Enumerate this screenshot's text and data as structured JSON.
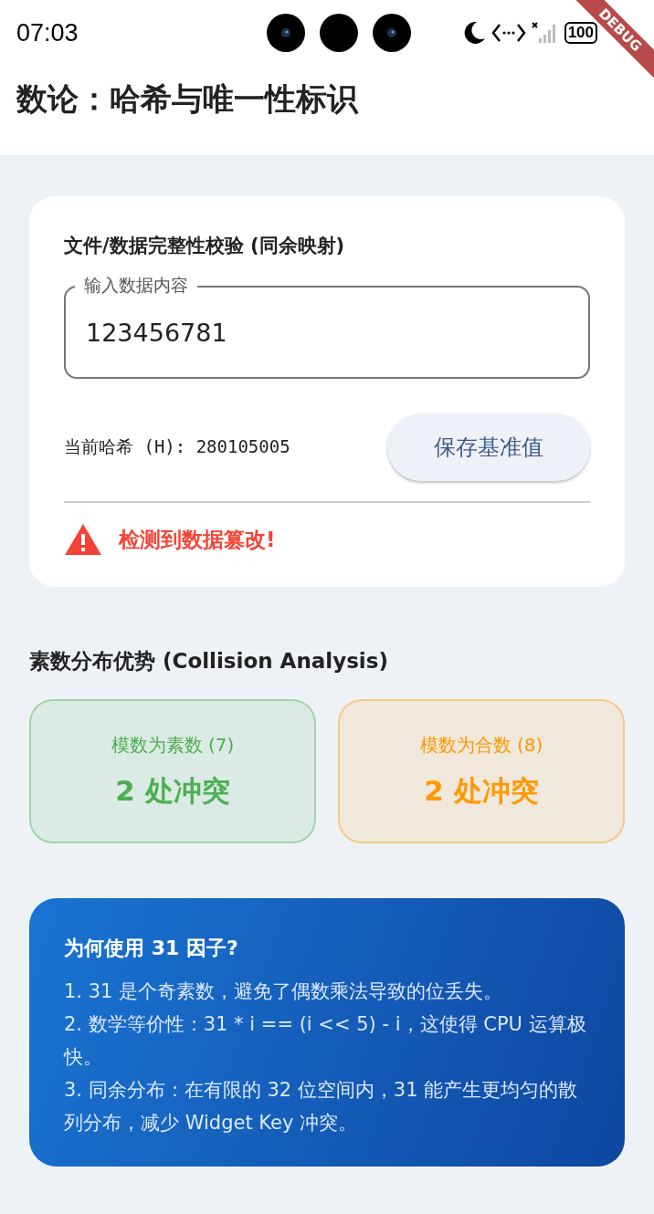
{
  "status_bar": {
    "time": "07:03",
    "battery": "100"
  },
  "debug_banner": "DEBUG",
  "app_bar": {
    "title": "数论：哈希与唯一性标识"
  },
  "integrity_card": {
    "title": "文件/数据完整性校验 (同余映射)",
    "input": {
      "label": "输入数据内容",
      "value": "123456781"
    },
    "hash_label": "当前哈希 (H): 280105005",
    "button": "保存基准值",
    "alert": {
      "kind": "warning",
      "text": "检测到数据篡改!"
    }
  },
  "collision": {
    "title": "素数分布优势 (Collision Analysis)",
    "cards": [
      {
        "label": "模数为素数 (7)",
        "value": "2 处冲突",
        "color": "#4caf50"
      },
      {
        "label": "模数为合数 (8)",
        "value": "2 处冲突",
        "color": "#ff9800"
      }
    ]
  },
  "info_card": {
    "title": "为何使用 31 因子?",
    "paragraphs": [
      "1. 31 是个奇素数，避免了偶数乘法导致的位丢失。",
      "2. 数学等价性：31 * i == (i << 5) - i，这使得 CPU 运算极快。",
      "3. 同余分布：在有限的 32 位空间内，31 能产生更均匀的散列分布，减少 Widget Key 冲突。"
    ]
  }
}
